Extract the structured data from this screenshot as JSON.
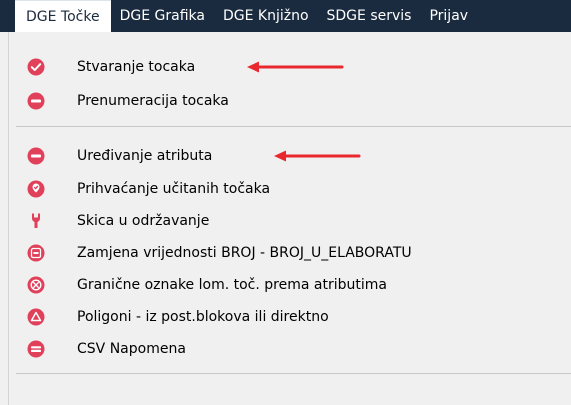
{
  "menubar": {
    "tabs": [
      "DGE Točke",
      "DGE Grafika",
      "DGE Knjižno",
      "SDGE servis",
      "Prijav"
    ]
  },
  "menu": {
    "items": [
      {
        "label": "Stvaranje tocaka",
        "icon": "check-circle-icon"
      },
      {
        "label": "Prenumeracija tocaka",
        "icon": "renumber-icon"
      },
      {
        "label": "Uređivanje atributa",
        "icon": "attribute-edit-icon"
      },
      {
        "label": "Prihvaćanje učitanih točaka",
        "icon": "accept-points-icon"
      },
      {
        "label": "Skica u održavanje",
        "icon": "wrench-icon"
      },
      {
        "label": "Zamjena vrijednosti BROJ - BROJ_U_ELABORATU",
        "icon": "replace-value-icon"
      },
      {
        "label": "Granične oznake lom. toč. prema atributima",
        "icon": "boundary-mark-icon"
      },
      {
        "label": "Poligoni - iz post.blokova ili direktno",
        "icon": "polygon-icon"
      },
      {
        "label": "CSV Napomena",
        "icon": "csv-note-icon"
      }
    ]
  },
  "colors": {
    "menubar_bg": "#1b2b3f",
    "icon": "#e0405a",
    "arrow": "#e8282e"
  }
}
